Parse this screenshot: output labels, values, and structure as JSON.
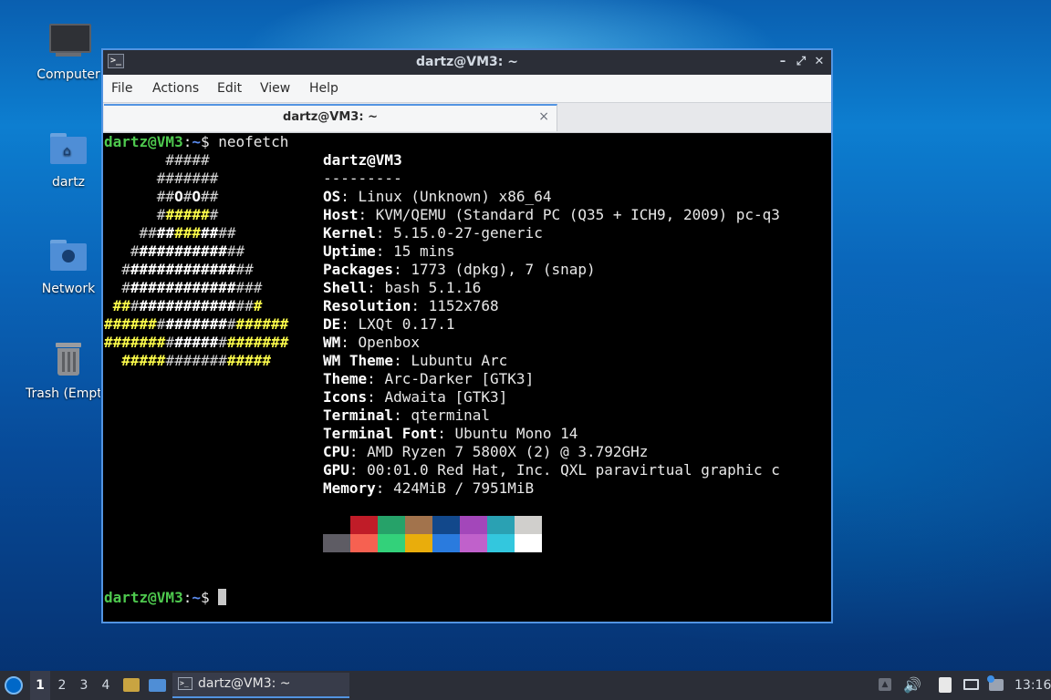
{
  "desktop": {
    "icons": [
      {
        "label": "Computer"
      },
      {
        "label": "dartz"
      },
      {
        "label": "Network"
      },
      {
        "label": "Trash (Empty)"
      }
    ]
  },
  "window": {
    "title": "dartz@VM3: ~",
    "menu": [
      "File",
      "Actions",
      "Edit",
      "View",
      "Help"
    ],
    "tab_label": "dartz@VM3: ~",
    "tab_close": "×",
    "controls": {
      "minimize": "–",
      "maximize": "⤢",
      "close": "✕"
    }
  },
  "terminal": {
    "prompt_user": "dartz@VM3",
    "prompt_colon": ":",
    "prompt_path": "~",
    "prompt_dollar": "$",
    "command": "neofetch",
    "header": "dartz@VM3",
    "separator": "---------",
    "info": [
      {
        "key": "OS",
        "value": "Linux (Unknown) x86_64"
      },
      {
        "key": "Host",
        "value": "KVM/QEMU (Standard PC (Q35 + ICH9, 2009) pc-q3"
      },
      {
        "key": "Kernel",
        "value": "5.15.0-27-generic"
      },
      {
        "key": "Uptime",
        "value": "15 mins"
      },
      {
        "key": "Packages",
        "value": "1773 (dpkg), 7 (snap)"
      },
      {
        "key": "Shell",
        "value": "bash 5.1.16"
      },
      {
        "key": "Resolution",
        "value": "1152x768"
      },
      {
        "key": "DE",
        "value": "LXQt 0.17.1"
      },
      {
        "key": "WM",
        "value": "Openbox"
      },
      {
        "key": "WM Theme",
        "value": "Lubuntu Arc"
      },
      {
        "key": "Theme",
        "value": "Arc-Darker [GTK3]"
      },
      {
        "key": "Icons",
        "value": "Adwaita [GTK3]"
      },
      {
        "key": "Terminal",
        "value": "qterminal"
      },
      {
        "key": "Terminal Font",
        "value": "Ubuntu Mono 14"
      },
      {
        "key": "CPU",
        "value": "AMD Ryzen 7 5800X (2) @ 3.792GHz"
      },
      {
        "key": "GPU",
        "value": "00:01.0 Red Hat, Inc. QXL paravirtual graphic c"
      },
      {
        "key": "Memory",
        "value": "424MiB / 7951MiB"
      }
    ],
    "ascii_art": [
      [
        {
          "t": "       #####",
          "c": "w"
        }
      ],
      [
        {
          "t": "      #######",
          "c": "w"
        }
      ],
      [
        {
          "t": "      ##",
          "c": "w"
        },
        {
          "t": "O",
          "c": "b"
        },
        {
          "t": "#",
          "c": "w"
        },
        {
          "t": "O",
          "c": "b"
        },
        {
          "t": "##",
          "c": "w"
        }
      ],
      [
        {
          "t": "      #",
          "c": "w"
        },
        {
          "t": "#####",
          "c": "y"
        },
        {
          "t": "#",
          "c": "w"
        }
      ],
      [
        {
          "t": "    ##",
          "c": "w"
        },
        {
          "t": "##",
          "c": "b"
        },
        {
          "t": "###",
          "c": "y"
        },
        {
          "t": "##",
          "c": "b"
        },
        {
          "t": "##",
          "c": "w"
        }
      ],
      [
        {
          "t": "   #",
          "c": "w"
        },
        {
          "t": "##########",
          "c": "b"
        },
        {
          "t": "##",
          "c": "w"
        }
      ],
      [
        {
          "t": "  #",
          "c": "w"
        },
        {
          "t": "############",
          "c": "b"
        },
        {
          "t": "##",
          "c": "w"
        }
      ],
      [
        {
          "t": "  #",
          "c": "w"
        },
        {
          "t": "############",
          "c": "b"
        },
        {
          "t": "###",
          "c": "w"
        }
      ],
      [
        {
          "t": " ##",
          "c": "y"
        },
        {
          "t": "#",
          "c": "w"
        },
        {
          "t": "###########",
          "c": "b"
        },
        {
          "t": "##",
          "c": "w"
        },
        {
          "t": "#",
          "c": "y"
        }
      ],
      [
        {
          "t": "######",
          "c": "y"
        },
        {
          "t": "#",
          "c": "w"
        },
        {
          "t": "#######",
          "c": "b"
        },
        {
          "t": "#",
          "c": "w"
        },
        {
          "t": "######",
          "c": "y"
        }
      ],
      [
        {
          "t": "#######",
          "c": "y"
        },
        {
          "t": "#",
          "c": "w"
        },
        {
          "t": "#####",
          "c": "b"
        },
        {
          "t": "#",
          "c": "w"
        },
        {
          "t": "#######",
          "c": "y"
        }
      ],
      [
        {
          "t": "  #####",
          "c": "y"
        },
        {
          "t": "#######",
          "c": "w"
        },
        {
          "t": "#####",
          "c": "y"
        }
      ]
    ],
    "palette_row1": [
      "#000000",
      "#c01c28",
      "#26a269",
      "#a2734c",
      "#12488b",
      "#a347ba",
      "#2aa1b3",
      "#d0cfcc"
    ],
    "palette_row2": [
      "#5e5c64",
      "#f66151",
      "#33d17a",
      "#e9ad0c",
      "#2a7bde",
      "#c061cb",
      "#33c7de",
      "#ffffff"
    ]
  },
  "taskbar": {
    "workspaces": [
      "1",
      "2",
      "3",
      "4"
    ],
    "task_label": "dartz@VM3: ~",
    "clock": "13:16"
  }
}
